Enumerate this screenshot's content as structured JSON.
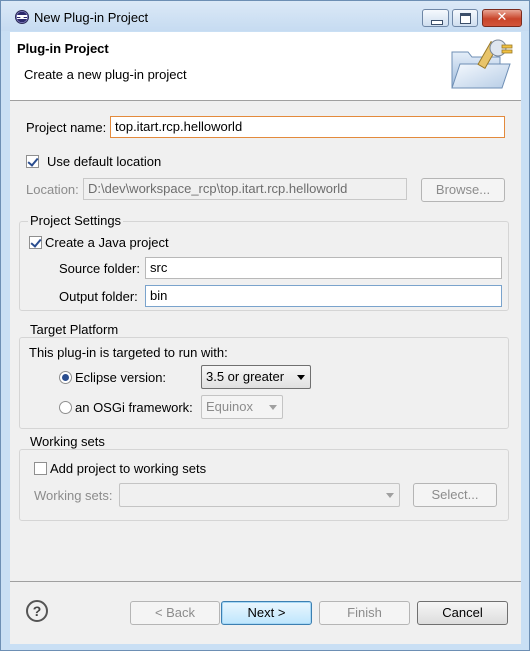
{
  "window": {
    "title": "New Plug-in Project"
  },
  "banner": {
    "title": "Plug-in Project",
    "description": "Create a new plug-in project"
  },
  "project": {
    "name_label": "Project name:",
    "name_value": "top.itart.rcp.helloworld",
    "use_default_location_label": "Use default location",
    "location_label": "Location:",
    "location_value": "D:\\dev\\workspace_rcp\\top.itart.rcp.helloworld",
    "browse_label": "Browse..."
  },
  "project_settings": {
    "title": "Project Settings",
    "create_java_label": "Create a Java project",
    "source_folder_label": "Source folder:",
    "source_folder_value": "src",
    "output_folder_label": "Output folder:",
    "output_folder_value": "bin"
  },
  "target_platform": {
    "title": "Target Platform",
    "description": "This plug-in is targeted to run with:",
    "eclipse_label": "Eclipse version:",
    "eclipse_value": "3.5 or greater",
    "osgi_label": "an OSGi framework:",
    "osgi_value": "Equinox"
  },
  "working_sets": {
    "title": "Working sets",
    "add_label": "Add project to working sets",
    "sets_label": "Working sets:",
    "select_label": "Select..."
  },
  "footer": {
    "help_glyph": "?",
    "back_label": "< Back",
    "next_label": "Next >",
    "finish_label": "Finish",
    "cancel_label": "Cancel"
  },
  "window_controls": {
    "close_glyph": "✕"
  }
}
